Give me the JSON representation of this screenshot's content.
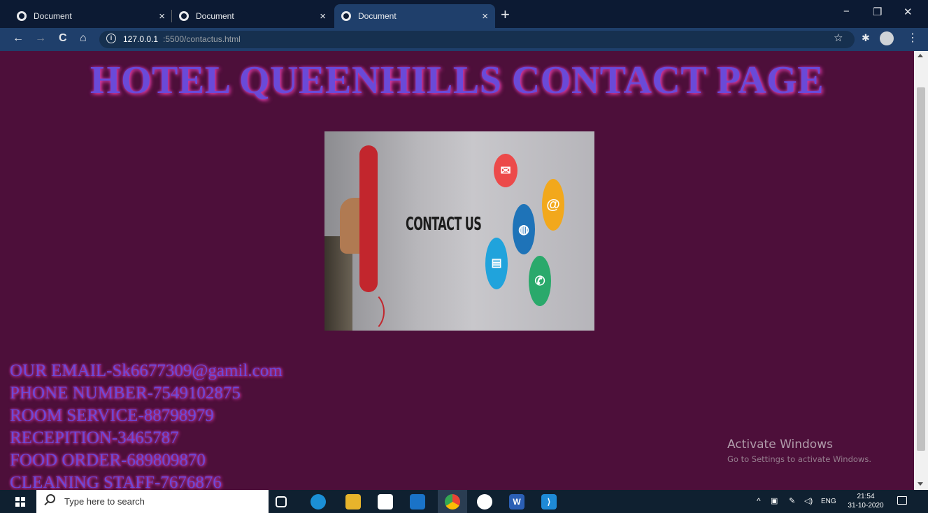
{
  "browser": {
    "tabs": [
      {
        "title": "Document",
        "active": false
      },
      {
        "title": "Document",
        "active": false
      },
      {
        "title": "Document",
        "active": true
      }
    ],
    "close_glyph": "×",
    "newtab_glyph": "+",
    "window_controls": {
      "minimize": "−",
      "restore": "❐",
      "close": "✕"
    },
    "nav": {
      "back": "←",
      "forward": "→",
      "reload": "C",
      "home": "⌂"
    },
    "url_host": "127.0.0.1",
    "url_path": ":5500/contactus.html",
    "bookmark_star": "☆",
    "extension_glyph": "✱",
    "menu_glyph": "⋮"
  },
  "page": {
    "title": "HOTEL QUEENHILLS CONTACT PAGE",
    "image_text": "CONTACT US",
    "contacts": [
      "OUR EMAIL-Sk6677309@gamil.com",
      "PHONE NUMBER-7549102875",
      "ROOM SERVICE-88798979",
      "RECEPITION-3465787",
      "FOOD ORDER-689809870",
      "CLEANING STAFF-7676876"
    ]
  },
  "watermark": {
    "title": "Activate Windows",
    "subtitle": "Go to Settings to activate Windows."
  },
  "taskbar": {
    "search_placeholder": "Type here to search",
    "tray": {
      "chevron": "^",
      "language": "ENG",
      "time": "21:54",
      "date": "31-10-2020"
    }
  },
  "colors": {
    "page_bg": "#4d0f3a",
    "text_purple": "#6a4ad8",
    "glow_pink": "#e03a9b",
    "tab_bg": "#0c1a33",
    "toolbar_bg": "#1f3f6b"
  }
}
